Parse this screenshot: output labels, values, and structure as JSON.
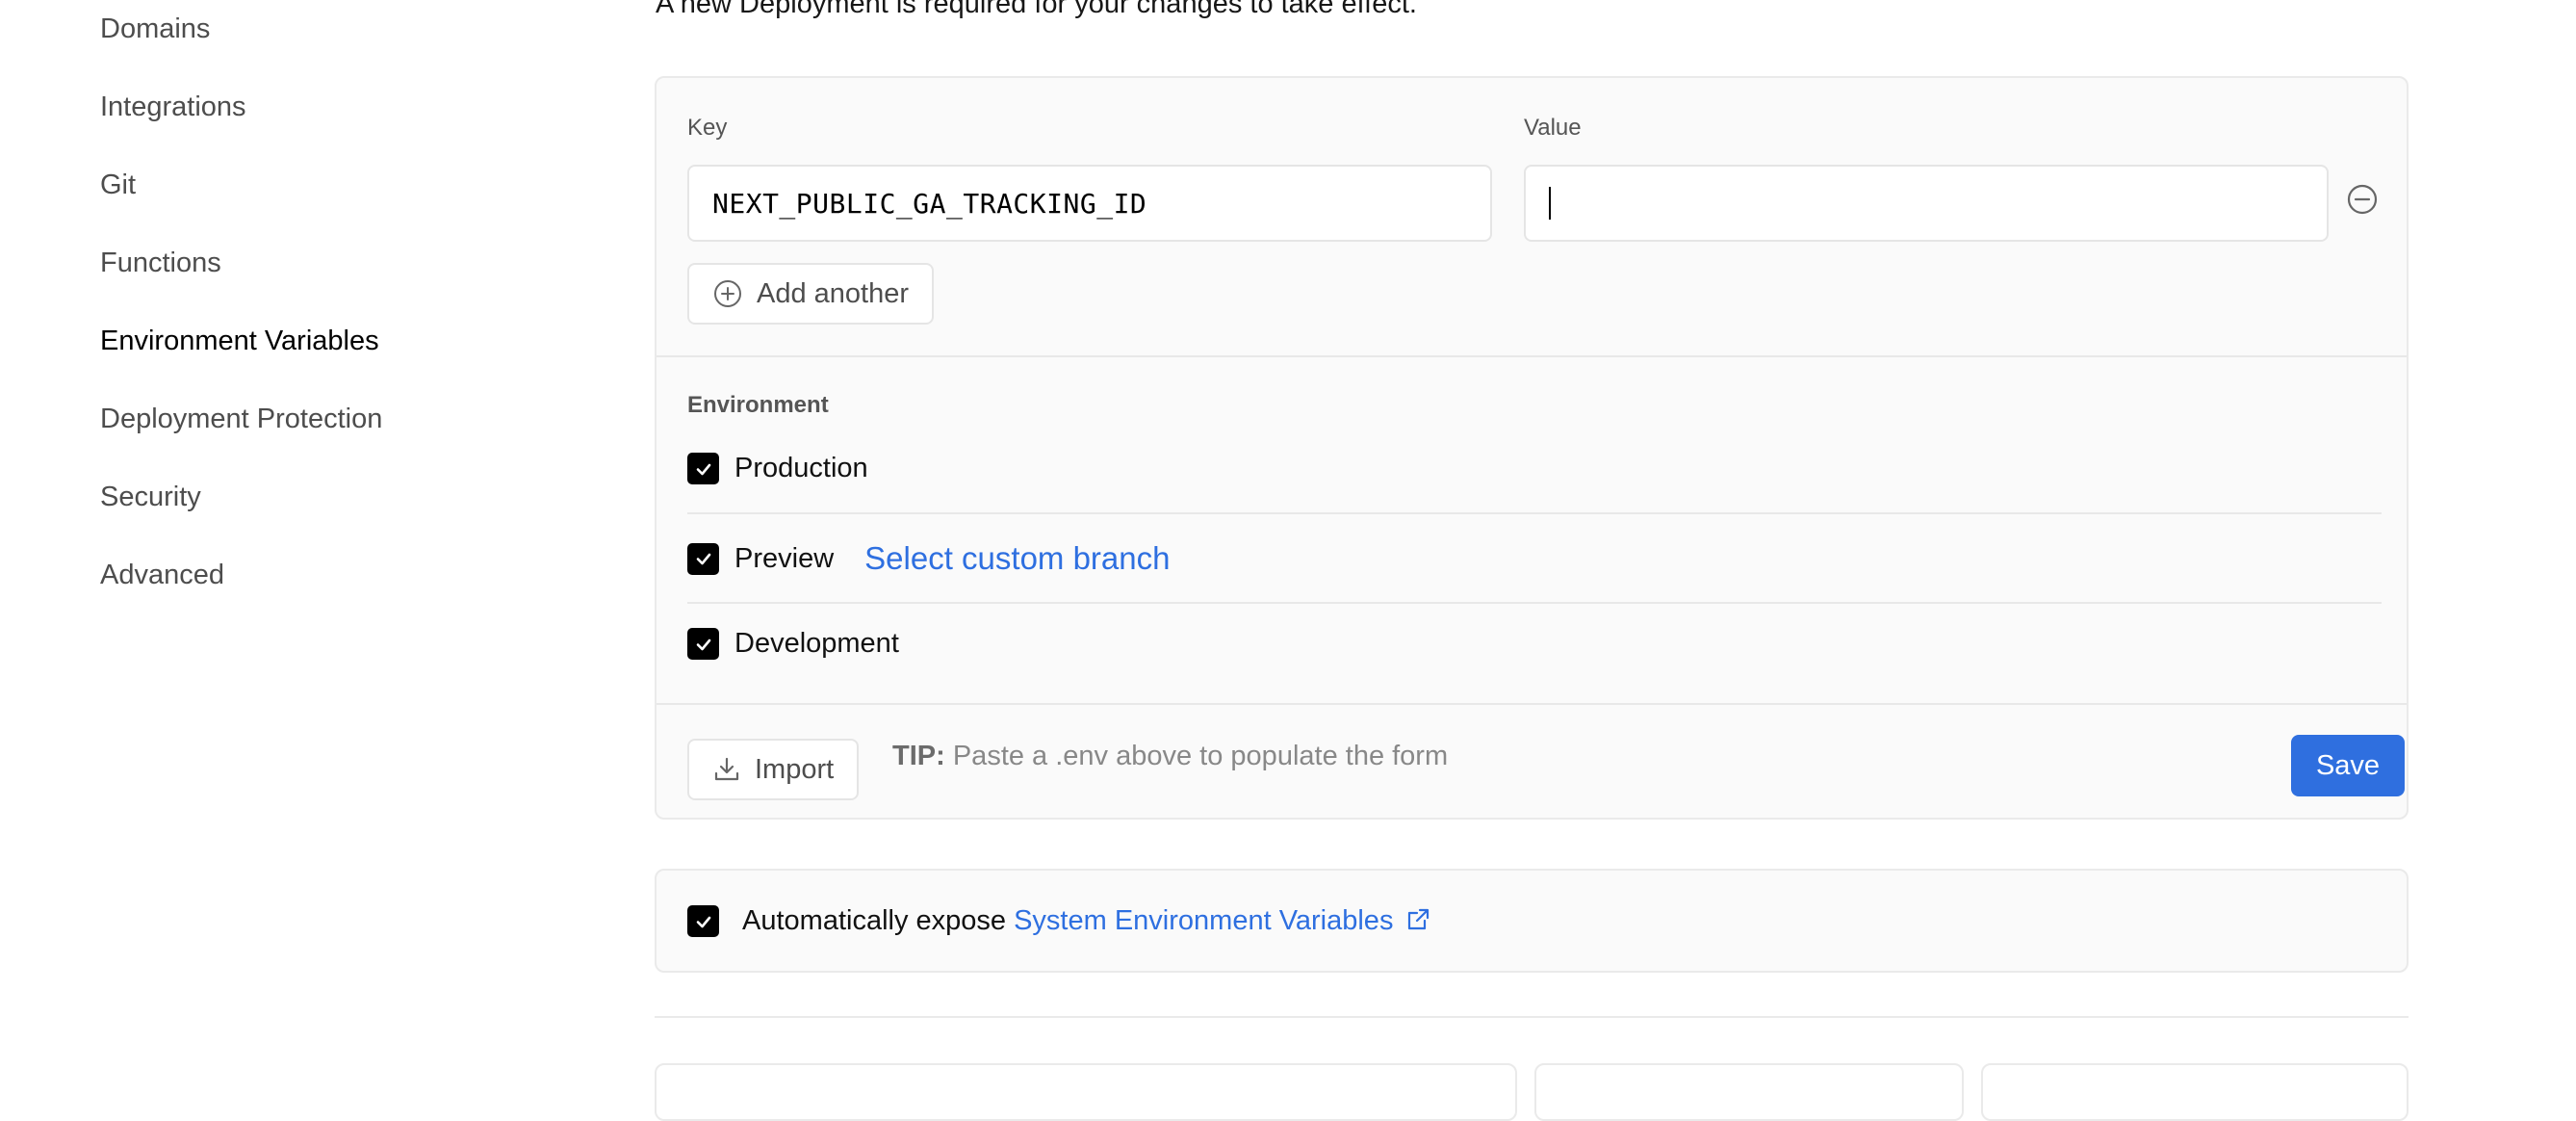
{
  "sidebar": {
    "items": [
      {
        "label": "Domains"
      },
      {
        "label": "Integrations"
      },
      {
        "label": "Git"
      },
      {
        "label": "Functions"
      },
      {
        "label": "Environment Variables"
      },
      {
        "label": "Deployment Protection"
      },
      {
        "label": "Security"
      },
      {
        "label": "Advanced"
      }
    ],
    "active": "Environment Variables"
  },
  "notice": "A new Deployment is required for your changes to take effect.",
  "form": {
    "key_label": "Key",
    "value_label": "Value",
    "key_value": "NEXT_PUBLIC_GA_TRACKING_ID",
    "value_value": "",
    "add_another": "Add another",
    "environment_title": "Environment",
    "environments": [
      {
        "label": "Production",
        "checked": true
      },
      {
        "label": "Preview",
        "checked": true,
        "link": "Select custom branch"
      },
      {
        "label": "Development",
        "checked": true
      }
    ],
    "import_label": "Import",
    "tip_bold": "TIP:",
    "tip_text": "Paste a .env above to populate the form",
    "save_label": "Save"
  },
  "expose": {
    "checked": true,
    "text": "Automatically expose",
    "link": "System Environment Variables"
  },
  "colors": {
    "accent": "#2f6fdf",
    "link": "#2e6fe0"
  }
}
